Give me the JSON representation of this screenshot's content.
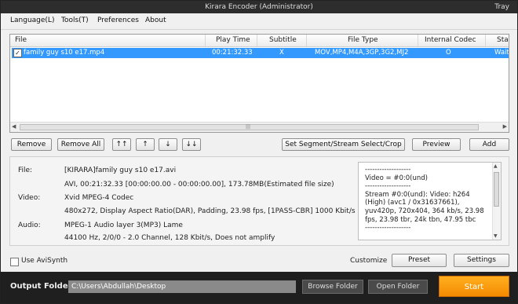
{
  "window": {
    "title": "Kirara Encoder (Administrator)",
    "tray": "Tray"
  },
  "menu": {
    "language": "Language(L)",
    "tools": "Tools(T)",
    "preferences": "Preferences",
    "about": "About"
  },
  "list": {
    "columns": [
      "File",
      "Play Time",
      "Subtitle",
      "File Type",
      "Internal Codec",
      "Stat"
    ],
    "rows": [
      {
        "checked": true,
        "file": "family guy s10 e17.mp4",
        "play_time": "00:21:32.33",
        "subtitle": "X",
        "file_type": "MOV,MP4,M4A,3GP,3G2,MJ2",
        "internal_codec": "O",
        "status": "Wait"
      }
    ]
  },
  "buttons": {
    "remove": "Remove",
    "remove_all": "Remove All",
    "top": "↑↑",
    "up": "↑",
    "down": "↓",
    "bottom": "↓↓",
    "segment": "Set Segment/Stream Select/Crop",
    "preview": "Preview",
    "add": "Add"
  },
  "info": {
    "file_label": "File:",
    "file_name": "[KIRARA]family guy s10 e17.avi",
    "file_details": "AVI, 00:21:32.33 [00:00:00.00 - 00:00:00.00], 173.78MB(Estimated file size)",
    "video_label": "Video:",
    "video_codec": "Xvid MPEG-4 Codec",
    "video_details": "480x272, Display Aspect Ratio(DAR), Padding, 23.98 fps, [1PASS-CBR] 1000 Kbit/s",
    "audio_label": "Audio:",
    "audio_codec": "MPEG-1 Audio layer 3(MP3) Lame",
    "audio_details": "44100 Hz, 2/0/0 - 2.0 Channel, 128 Kbit/s, Does not amplify",
    "stream_text": "-------------------\nVideo = #0:0(und)\n-------------------\nStream #0:0(und): Video: h264 (High) (avc1 / 0x31637661), yuv420p, 720x404, 364 kb/s, 23.98 fps, 23.98 tbr, 24k tbn, 47.95 tbc\n-------------------"
  },
  "options": {
    "use_avisynth": "Use AviSynth",
    "customize": "Customize",
    "preset": "Preset",
    "settings": "Settings"
  },
  "output": {
    "label": "Output Folder",
    "path": "C:\\Users\\Abdullah\\Desktop",
    "browse": "Browse Folder",
    "open": "Open Folder",
    "start": "Start"
  }
}
